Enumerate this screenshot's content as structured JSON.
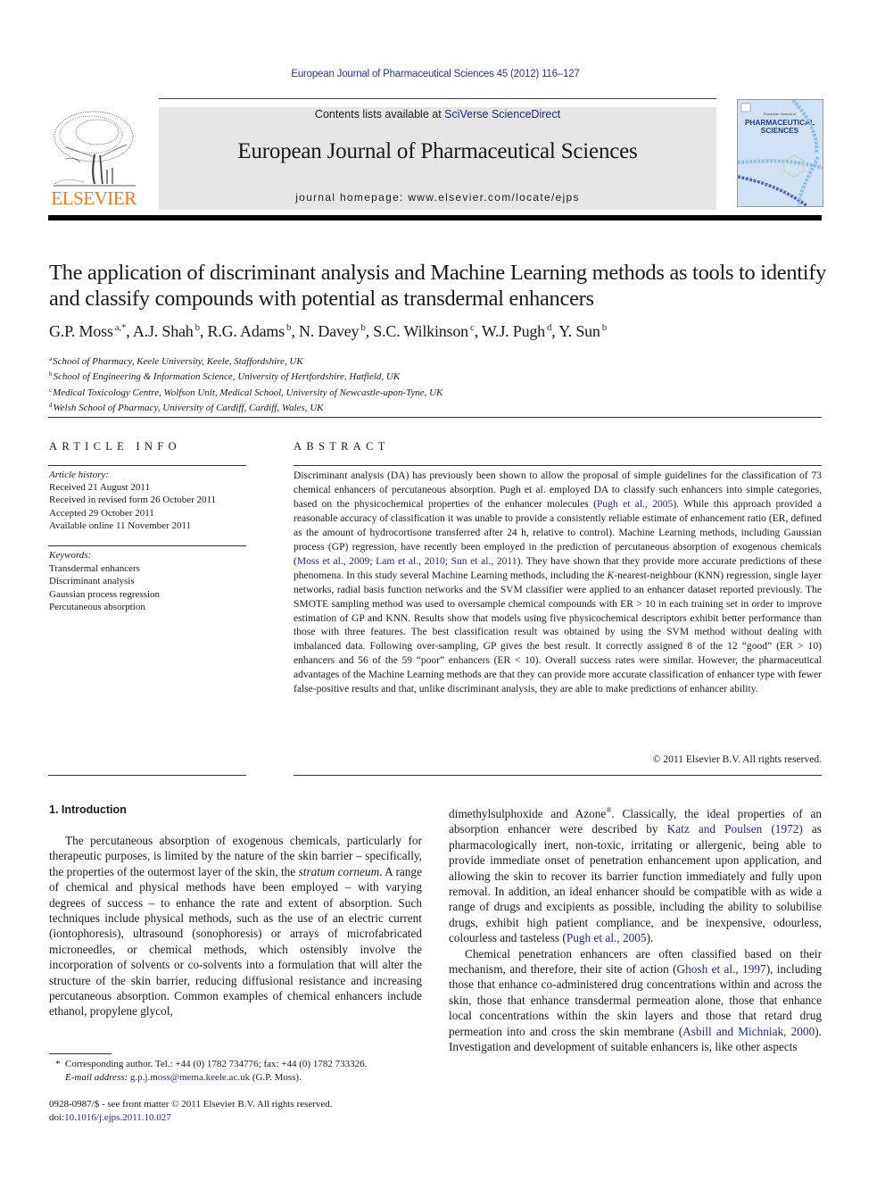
{
  "running_head": "European Journal of Pharmaceutical Sciences 45 (2012) 116–127",
  "masthead": {
    "publisher_logo_text": "ELSEVIER",
    "contents_prefix": "Contents lists available at ",
    "contents_link": "SciVerse ScienceDirect",
    "journal_title": "European Journal of Pharmaceutical Sciences",
    "homepage": "journal homepage: www.elsevier.com/locate/ejps",
    "cover": {
      "small_line": "European Journal of",
      "title_line1": "PHARMACEUTICAL",
      "title_line2": "SCIENCES"
    }
  },
  "colors": {
    "link": "#1f2a8a",
    "elsevier_orange": "#f07a1a",
    "banner_gray": "#e6e6e6",
    "cover_blue": "#cfe1f3"
  },
  "article": {
    "title": "The application of discriminant analysis and Machine Learning methods as tools to identify and classify compounds with potential as transdermal enhancers",
    "authors": [
      {
        "name": "G.P. Moss",
        "sup": "a,*"
      },
      {
        "name": "A.J. Shah",
        "sup": "b"
      },
      {
        "name": "R.G. Adams",
        "sup": "b"
      },
      {
        "name": "N. Davey",
        "sup": "b"
      },
      {
        "name": "S.C. Wilkinson",
        "sup": "c"
      },
      {
        "name": "W.J. Pugh",
        "sup": "d"
      },
      {
        "name": "Y. Sun",
        "sup": "b"
      }
    ],
    "affiliations": [
      {
        "key": "a",
        "text": "School of Pharmacy, Keele University, Keele, Staffordshire, UK"
      },
      {
        "key": "b",
        "text": "School of Engineering & Information Science, University of Hertfordshire, Hatfield, UK"
      },
      {
        "key": "c",
        "text": "Medical Toxicology Centre, Wolfson Unit, Medical School, University of Newcastle-upon-Tyne, UK"
      },
      {
        "key": "d",
        "text": "Welsh School of Pharmacy, University of Cardiff, Cardiff, Wales, UK"
      }
    ]
  },
  "article_info": {
    "heading": "ARTICLE INFO",
    "history_label": "Article history:",
    "history": [
      "Received 21 August 2011",
      "Received in revised form 26 October 2011",
      "Accepted 29 October 2011",
      "Available online 11 November 2011"
    ],
    "keywords_label": "Keywords:",
    "keywords": [
      "Transdermal enhancers",
      "Discriminant analysis",
      "Gaussian process regression",
      "Percutaneous absorption"
    ]
  },
  "abstract": {
    "heading": "ABSTRACT",
    "segments": [
      {
        "t": "Discriminant analysis (DA) has previously been shown to allow the proposal of simple guidelines for the classification of 73 chemical enhancers of percutaneous absorption. Pugh et al. employed DA to classify such enhancers into simple categories, based on the physicochemical properties of the enhancer mole­cules ("
      },
      {
        "t": "Pugh et al., 2005",
        "link": true
      },
      {
        "t": "). While this approach provided a reasonable accuracy of classification it was unable to provide a consistently reliable estimate of enhancement ratio (ER, defined as the amount of hydrocortisone transferred after 24 h, relative to control). Machine Learning methods, including Gaussian process (GP) regression, have recently been employed in the prediction of percutaneous absorption of exogenous chemicals ("
      },
      {
        "t": "Moss et al., 2009; Lam et al., 2010; Sun et al., 2011",
        "link": true
      },
      {
        "t": "). They have shown that they provide more accurate predictions of these phenomena. In this study several Machine Learning methods, including the "
      },
      {
        "t": "K",
        "italic": true
      },
      {
        "t": "-nearest-neighbour (KNN) regression, single layer networks, radial basis function net­works and the SVM classifier were applied to an enhancer dataset reported previously. The SMOTE sam­pling method was used to oversample chemical compounds with ER > 10 in each training set in order to improve estimation of GP and KNN. Results show that models using five physicochemical descriptors exhibit better performance than those with three features. The best classification result was obtained by using the SVM method without dealing with imbalanced data. Following over-sampling, GP gives the best result. It correctly assigned 8 of the 12 “good” (ER > 10) enhancers and 56 of the 59 “poor” enhancers (ER < 10). Overall success rates were similar. However, the pharmaceutical advantages of the Machine Learning methods are that they can provide more accurate classification of enhancer type with fewer false-positive results and that, unlike discriminant analysis, they are able to make predictions of enhancer ability."
      }
    ],
    "copyright": "© 2011 Elsevier B.V. All rights reserved."
  },
  "body": {
    "section_heading": "1. Introduction",
    "left_column": [
      {
        "t": "The percutaneous absorption of exogenous chemicals, particu­larly for therapeutic purposes, is limited by the nature of the skin barrier – specifically, the properties of the outermost layer of the skin, the "
      },
      {
        "t": "stratum corneum",
        "italic": true
      },
      {
        "t": ". A range of chemical and physical meth­ods have been employed – with varying degrees of success – to en­hance the rate and extent of absorption. Such techniques include physical methods, such as the use of an electric current (iontopho­resis), ultrasound (sonophoresis) or arrays of microfabricated microneedles, or chemical methods, which ostensibly involve the incorporation of solvents or co-solvents into a formulation that will alter the structure of the skin barrier, reducing diffusional resistance and increasing percutaneous absorption. Common examples of chemical enhancers include ethanol, propylene glycol,"
      }
    ],
    "right_column_p1": [
      {
        "t": "dimethylsulphoxide and Azone"
      },
      {
        "t": "®",
        "sup": true
      },
      {
        "t": ". Classically, the ideal properties of an absorption enhancer were described by "
      },
      {
        "t": "Katz and Poulsen (1972)",
        "link": true
      },
      {
        "t": " as pharmacologically inert, non-toxic, irritating or allergenic, being able to provide immediate onset of penetration enhancement upon application, and allowing the skin to recover its barrier function immediately and fully upon removal. In addition, an ideal enhancer should be compatible with as wide a range of drugs and excipients as possible, including the ability to solubilise drugs, exhibit high patient compliance, and be inexpensive, odourless, colourless and tasteless ("
      },
      {
        "t": "Pugh et al., 2005",
        "link": true
      },
      {
        "t": ")."
      }
    ],
    "right_column_p2": [
      {
        "t": "Chemical penetration enhancers are often classified based on their mechanism, and therefore, their site of action ("
      },
      {
        "t": "Ghosh et al., 1997",
        "link": true
      },
      {
        "t": "), including those that enhance co-administered drug concen­trations within and across the skin, those that enhance transder­mal permeation alone, those that enhance local concentrations within the skin layers and those that retard drug permeation into and cross the skin membrane ("
      },
      {
        "t": "Asbill and Michniak, 2000",
        "link": true
      },
      {
        "t": "). Investi­gation and development of suitable enhancers is, like other aspects"
      }
    ]
  },
  "footnotes": {
    "corresponding_marker": "*",
    "corresponding_text": "Corresponding author. Tel.: +44 (0) 1782 734776; fax: +44 (0) 1782 733326.",
    "email_label": "E-mail address:",
    "email": "g.p.j.moss@mema.keele.ac.uk",
    "email_suffix": "(G.P. Moss).",
    "front_matter": "0928-0987/$ - see front matter © 2011 Elsevier B.V. All rights reserved.",
    "doi_prefix": "doi:",
    "doi": "10.1016/j.ejps.2011.10.027"
  }
}
